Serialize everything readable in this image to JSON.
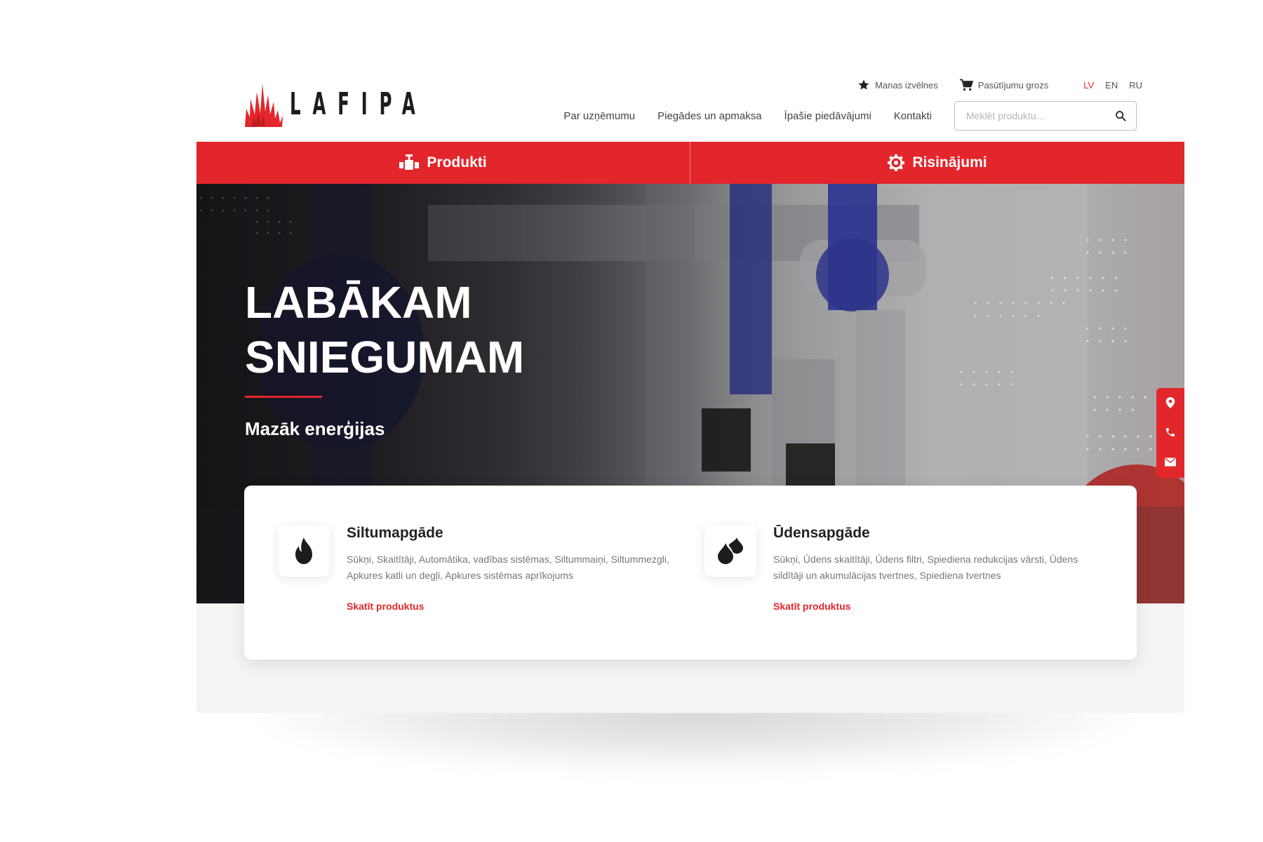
{
  "header": {
    "logo_text": "LAFIPA",
    "utility": {
      "favorites_label": "Manas izvēlnes",
      "cart_label": "Pasūtījumu grozs"
    },
    "languages": [
      "LV",
      "EN",
      "RU"
    ],
    "active_language": "LV",
    "nav": [
      "Par uzņēmumu",
      "Piegādes un apmaksa",
      "Īpašie piedāvājumi",
      "Kontakti"
    ],
    "search": {
      "placeholder": "Meklēt produktu..."
    }
  },
  "main_tabs": [
    {
      "label": "Produkti",
      "icon": "valve-icon"
    },
    {
      "label": "Risinājumi",
      "icon": "gear-icon"
    }
  ],
  "hero": {
    "title_line1": "LABĀKAM",
    "title_line2": "SNIEGUMAM",
    "subtitle": "Mazāk enerģijas"
  },
  "side_contacts": [
    "location-icon",
    "phone-icon",
    "mail-icon"
  ],
  "categories": [
    {
      "title": "Siltumapgāde",
      "description": "Sūkņi, Skaitītāji, Automātika, vadības sistēmas, Siltummaiņi, Siltummezgli, Apkures katli un degļi, Apkures sistēmas aprīkojums",
      "link": "Skatīt produktus",
      "icon": "flame-icon"
    },
    {
      "title": "Ūdensapgāde",
      "description": "Sūkņi, Ūdens skaitītāji, Ūdens filtri, Spiediena redukcijas vārsti, Ūdens sildītāji un akumulācijas tvertnes, Spiediena tvertnes",
      "link": "Skatīt produktus",
      "icon": "water-drops-icon"
    }
  ],
  "colors": {
    "accent": "#e3262b",
    "text_dark": "#222222",
    "text_muted": "#777777",
    "background": "#f4f4f4"
  }
}
